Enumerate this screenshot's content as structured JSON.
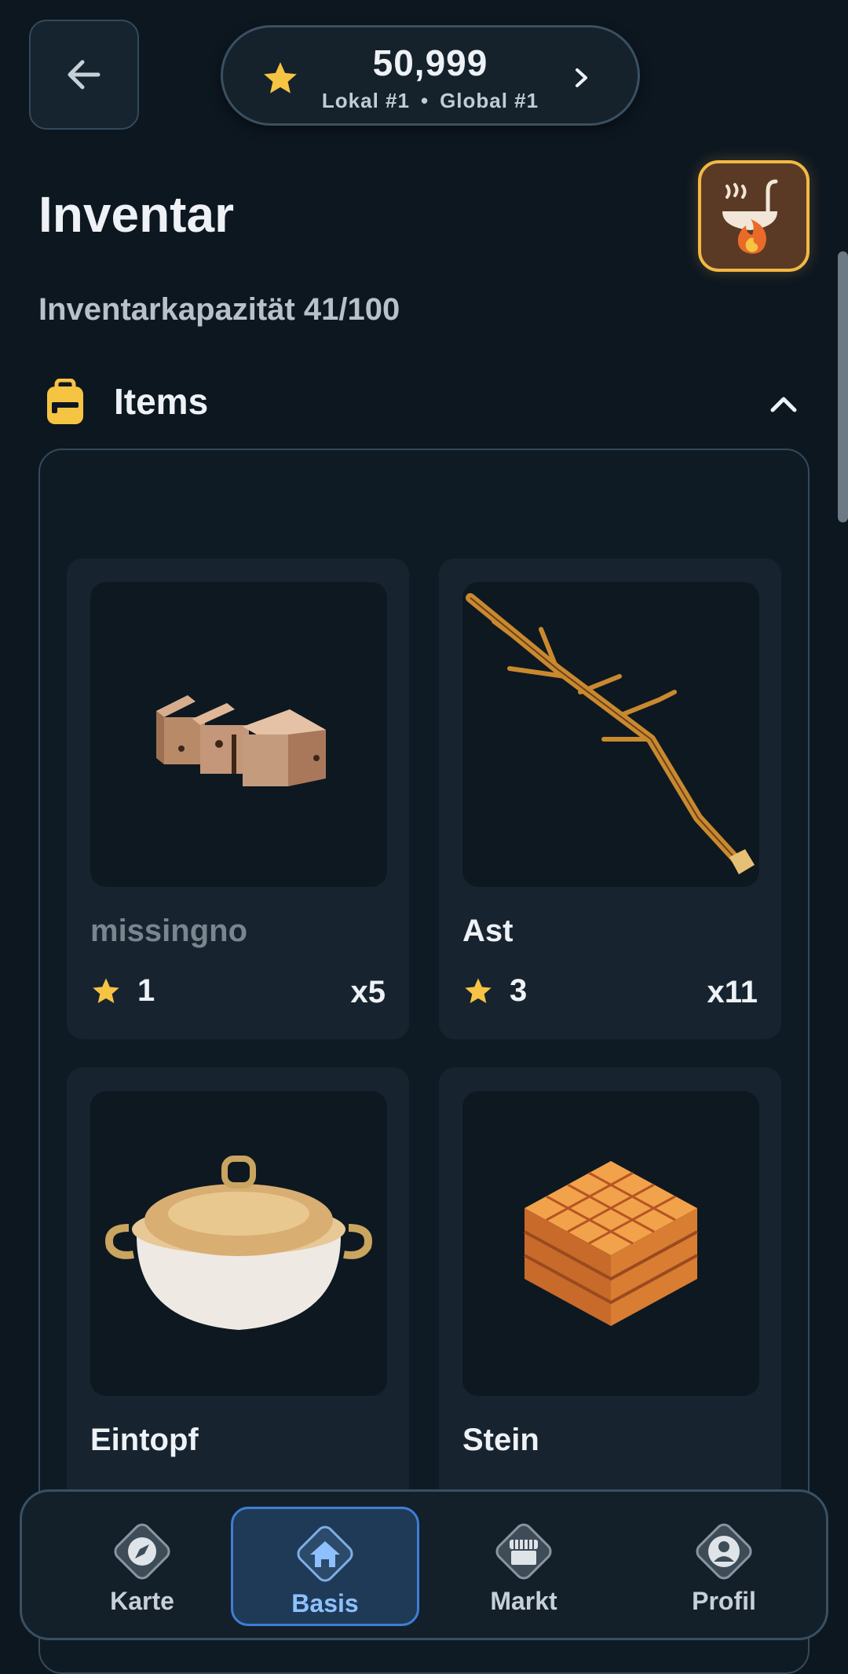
{
  "header": {
    "score": {
      "value": "50,999",
      "local_rank": "Lokal #1",
      "separator": "•",
      "global_rank": "Global #1",
      "icon": "star-icon",
      "star_color": "#f6c443"
    },
    "back_icon": "arrow-left-icon",
    "chevron_icon": "chevron-right-icon"
  },
  "page": {
    "title": "Inventar",
    "capacity": "Inventarkapazität 41/100",
    "cook_icon": "ladle-fire-icon",
    "accent_color": "#f3b846"
  },
  "section": {
    "title": "Items",
    "icon": "backpack-icon",
    "toggle_icon": "chevron-up-icon"
  },
  "items": [
    {
      "name": "missingno",
      "rating": "1",
      "quantity": "x5",
      "image": "brick-bar-image"
    },
    {
      "name": "Ast",
      "rating": "3",
      "quantity": "x11",
      "image": "branch-image"
    },
    {
      "name": "Eintopf",
      "rating": "",
      "quantity": "",
      "image": "pot-image"
    },
    {
      "name": "Stein",
      "rating": "",
      "quantity": "",
      "image": "stone-block-image"
    }
  ],
  "nav": {
    "items": [
      {
        "label": "Karte",
        "icon": "compass-icon"
      },
      {
        "label": "Basis",
        "icon": "home-icon"
      },
      {
        "label": "Markt",
        "icon": "shop-icon"
      },
      {
        "label": "Profil",
        "icon": "user-icon"
      }
    ],
    "active": "Basis",
    "active_color": "#3f7ed6"
  }
}
